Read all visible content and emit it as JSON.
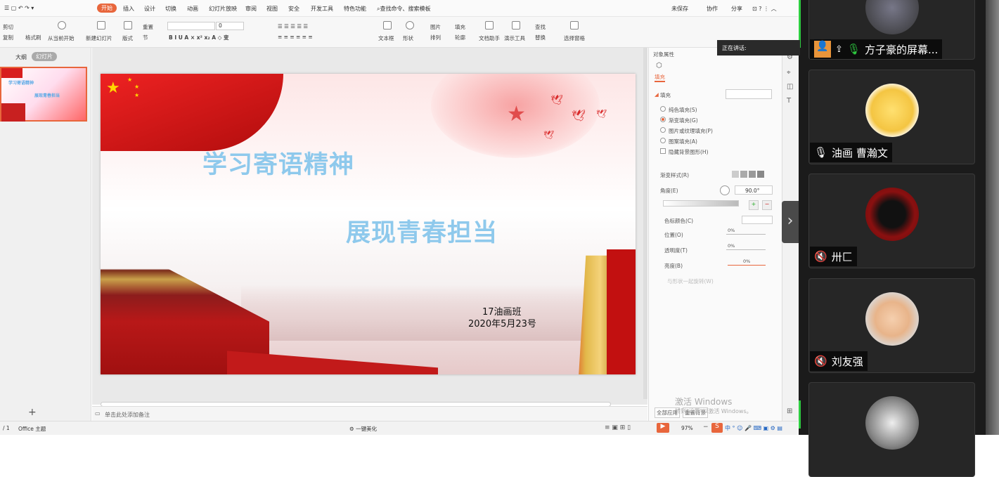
{
  "menubar": {
    "tabs": [
      "开始",
      "插入",
      "设计",
      "切换",
      "动画",
      "幻灯片放映",
      "审阅",
      "视图",
      "安全",
      "开发工具",
      "特色功能"
    ],
    "search": "查找命令、搜索模板",
    "right": [
      "未保存",
      "协作",
      "分享"
    ]
  },
  "toolbar": {
    "paste": "粘贴",
    "cut": "剪切",
    "copy": "复制",
    "format_painter": "格式刷",
    "from_current": "从当前开始",
    "new_slide": "新建幻灯片",
    "layout": "版式",
    "reset": "重置",
    "section": "节",
    "font_size": "0",
    "textbox": "文本框",
    "shapes": "形状",
    "image": "图片",
    "arrange": "排列",
    "fill": "填充",
    "outline": "轮廓",
    "text_assistant": "文档助手",
    "presentation_tools": "演示工具",
    "find": "查找",
    "replace": "替换",
    "select_pane": "选择窗格"
  },
  "leftpanel": {
    "tabs": [
      "大纲",
      "幻灯片"
    ],
    "slide_number": "1",
    "thumb_title": "学习寄语精神",
    "thumb_sub": "展现青春担当",
    "add": "+"
  },
  "slide": {
    "title": "学习寄语精神",
    "subtitle": "展现青春担当",
    "class": "17油画班",
    "date": "2020年5月23号"
  },
  "notes": {
    "placeholder": "单击此处添加备注"
  },
  "props": {
    "header": "对象属性",
    "tab": "填充",
    "section": "填充",
    "options": [
      "纯色填充(S)",
      "渐变填充(G)",
      "图片或纹理填充(P)",
      "图案填充(A)",
      "隐藏背景图形(H)"
    ],
    "gradient_style": "渐变样式(R)",
    "angle": "角度(E)",
    "angle_value": "90.0°",
    "stop_color": "色标颜色(C)",
    "position": "位置(O)",
    "transparency": "透明度(T)",
    "brightness": "亮度(B)",
    "pct": "0%",
    "rotate_with": "与形状一起旋转(W)",
    "apply_all": "全部应用",
    "reset_bg": "重置背景"
  },
  "watermark": {
    "line1": "激活 Windows",
    "line2": "转到\"设置\"以激活 Windows。"
  },
  "status": {
    "page": "/ 1",
    "theme": "Office 主题",
    "beautify": "一键美化",
    "zoom": "97%"
  },
  "speaking": {
    "label": "正在讲话:"
  },
  "participants": [
    {
      "name": "方子豪的屏幕...",
      "mic": "on",
      "screen": true
    },
    {
      "name": "油画 曹瀚文",
      "mic": "on"
    },
    {
      "name": "卅匚",
      "mic": "off"
    },
    {
      "name": "刘友强",
      "mic": "off"
    },
    {
      "name": "",
      "mic": ""
    }
  ],
  "colors": {
    "accent": "#e8663c",
    "slide_text": "#8ec9ec",
    "meeting_bg": "#1b1b1b"
  }
}
